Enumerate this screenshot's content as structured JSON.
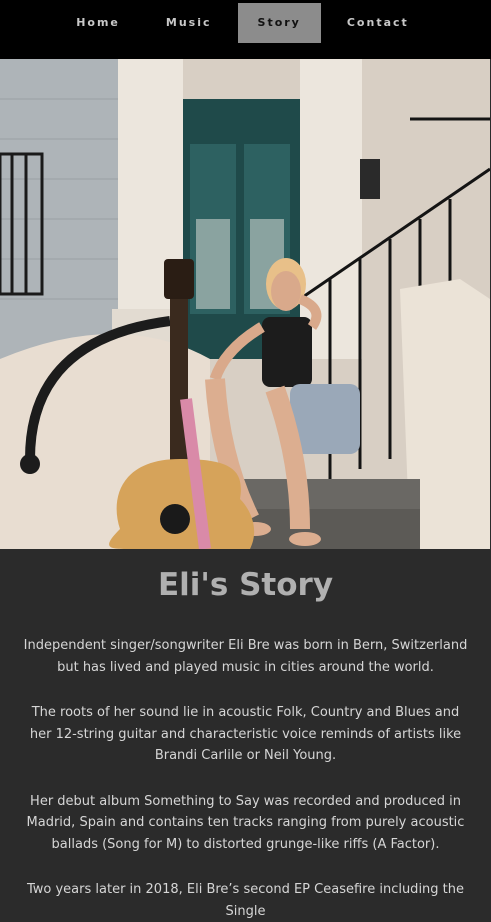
{
  "nav": {
    "items": [
      {
        "label": "Home"
      },
      {
        "label": "Music"
      },
      {
        "label": "Story",
        "active": true
      },
      {
        "label": "Contact"
      }
    ],
    "active_color": "#8c8c8c"
  },
  "hero": {
    "subject": "woman sitting on stoop steps with acoustic guitar"
  },
  "story": {
    "title": "Eli's Story",
    "paragraphs": [
      "Independent singer/songwriter Eli Bre was born in Bern, Switzerland but has lived and played music in cities around the world.",
      "The roots of her sound lie in acoustic Folk, Country and Blues and her 12-string guitar and characteristic voice reminds of artists like Brandi Carlile or Neil Young.",
      "Her debut album Something to Say was recorded and produced in Madrid, Spain and contains ten tracks ranging from purely acoustic ballads (Song for M) to distorted grunge-like riffs (A Factor).",
      "Two years later in 2018, Eli Bre’s second EP Ceasefire including the Single"
    ]
  },
  "colors": {
    "nav_bg": "#000000",
    "page_bg": "#2b2b2b",
    "title": "#b0b0b0",
    "text": "#d6d6d6"
  }
}
